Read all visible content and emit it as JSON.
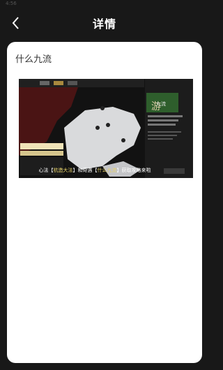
{
  "status_bar": {
    "time": "4:56"
  },
  "header": {
    "title": "详情",
    "back_icon": "chevron-left-icon"
  },
  "article": {
    "title": "什么九流",
    "video": {
      "caption_parts": [
        "心法【",
        "杭造大法",
        "】和奇遇【",
        "什么九流",
        "】获取攻略来啦"
      ],
      "poster_text": "九流"
    }
  }
}
